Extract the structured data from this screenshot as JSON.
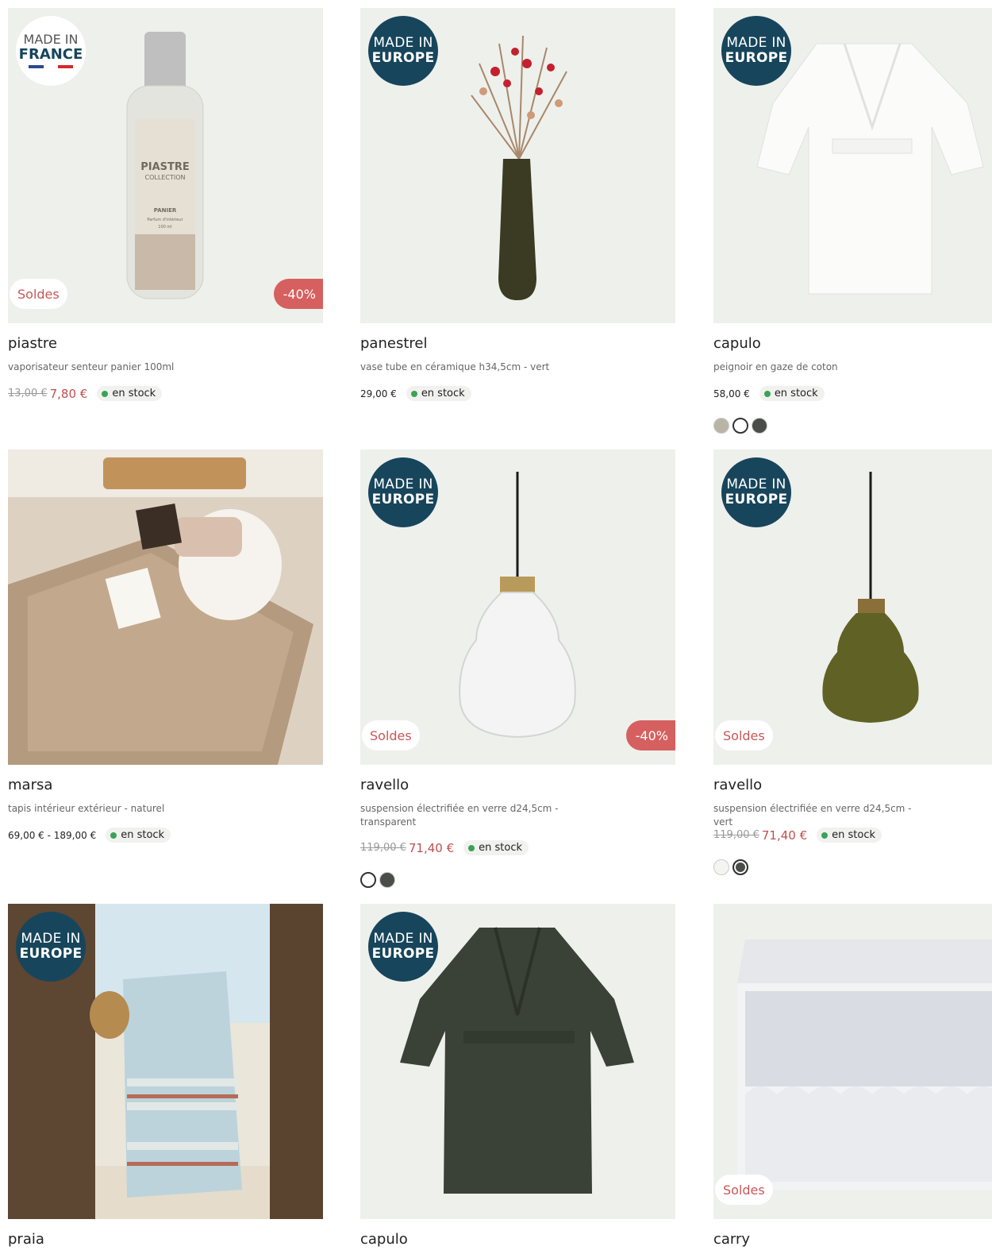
{
  "products": [
    {
      "name": "piastre",
      "description": "vaporisateur senteur panier 100ml",
      "badge": {
        "line1": "MADE IN",
        "line2": "FRANCE"
      },
      "tag": "Soldes",
      "discount": "-40%",
      "old_price": "13,00 €",
      "price": "7,80 €",
      "stock": "en stock",
      "image_text": {
        "brand": "PIASTRE",
        "collection": "COLLECTION",
        "scent": "PANIER",
        "type": "Parfum d'intérieur",
        "volume": "100 ml"
      }
    },
    {
      "name": "panestrel",
      "description": "vase tube en céramique h34,5cm - vert",
      "badge": {
        "line1": "MADE IN",
        "line2": "EUROPE"
      },
      "price": "29,00 €",
      "stock": "en stock"
    },
    {
      "name": "capulo",
      "description": "peignoir en gaze de coton",
      "badge": {
        "line1": "MADE IN",
        "line2": "EUROPE"
      },
      "price": "58,00 €",
      "stock": "en stock",
      "swatches": [
        "#b9b5a6",
        "#ffffff",
        "#4a4d4a"
      ],
      "selected_swatch": 1
    },
    {
      "name": "marsa",
      "description": "tapis intérieur extérieur - naturel",
      "price": "69,00 € - 189,00 €",
      "stock": "en stock"
    },
    {
      "name": "ravello",
      "description": "suspension électrifiée en verre d24,5cm - transparent",
      "badge": {
        "line1": "MADE IN",
        "line2": "EUROPE"
      },
      "tag": "Soldes",
      "discount": "-40%",
      "old_price": "119,00 €",
      "price": "71,40 €",
      "stock": "en stock",
      "swatches": [
        "#ffffff",
        "#4a4d4a"
      ],
      "selected_swatch": 0
    },
    {
      "name": "ravello",
      "description": "suspension électrifiée en verre d24,5cm - vert",
      "badge": {
        "line1": "MADE IN",
        "line2": "EUROPE"
      },
      "tag": "Soldes",
      "old_price": "119,00 €",
      "price": "71,40 €",
      "stock": "en stock",
      "swatches": [
        "#f4f4f2",
        "#4a4d4a"
      ],
      "selected_swatch": 1
    },
    {
      "name": "praia",
      "badge": {
        "line1": "MADE IN",
        "line2": "EUROPE"
      }
    },
    {
      "name": "capulo",
      "badge": {
        "line1": "MADE IN",
        "line2": "EUROPE"
      }
    },
    {
      "name": "carry",
      "tag": "Soldes"
    }
  ],
  "colors": {
    "badge_blue": "#17455c",
    "sale_red": "#d6605f",
    "price_red": "#c0504d",
    "stock_green": "#3aa356",
    "flag_blue": "#2b4a8c",
    "flag_red": "#d12b2b"
  }
}
